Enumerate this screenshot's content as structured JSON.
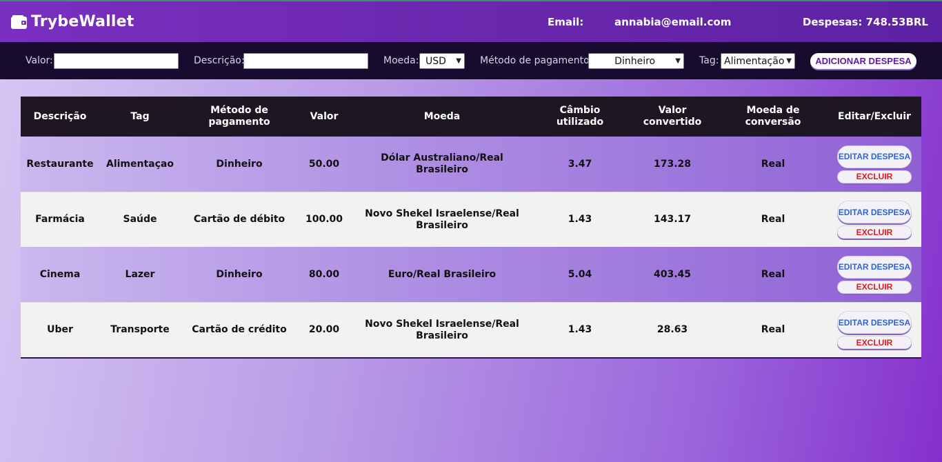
{
  "header": {
    "brand": "TrybeWallet",
    "email_label": "Email:",
    "email": "annabia@email.com",
    "expenses": "Despesas: 748.53BRL"
  },
  "form": {
    "value_label": "Valor:",
    "value": "",
    "description_label": "Descrição:",
    "description": "",
    "currency_label": "Moeda:",
    "currency": "USD",
    "method_label": "Método de pagamento:",
    "method": "Dinheiro",
    "tag_label": "Tag:",
    "tag": "Alimentação",
    "add_button": "ADICIONAR DESPESA"
  },
  "table": {
    "headers": [
      "Descrição",
      "Tag",
      "Método de pagamento",
      "Valor",
      "Moeda",
      "Câmbio utilizado",
      "Valor convertido",
      "Moeda de conversão",
      "Editar/Excluir"
    ],
    "edit_label": "EDITAR DESPESA",
    "delete_label": "EXCLUIR",
    "rows": [
      {
        "description": "Restaurante",
        "tag": "Alimentaçao",
        "method": "Dinheiro",
        "value": "50.00",
        "currency": "Dólar Australiano/Real Brasileiro",
        "rate": "3.47",
        "converted": "173.28",
        "conversion": "Real"
      },
      {
        "description": "Farmácia",
        "tag": "Saúde",
        "method": "Cartão de débito",
        "value": "100.00",
        "currency": "Novo Shekel Israelense/Real Brasileiro",
        "rate": "1.43",
        "converted": "143.17",
        "conversion": "Real"
      },
      {
        "description": "Cinema",
        "tag": "Lazer",
        "method": "Dinheiro",
        "value": "80.00",
        "currency": "Euro/Real Brasileiro",
        "rate": "5.04",
        "converted": "403.45",
        "conversion": "Real"
      },
      {
        "description": "Uber",
        "tag": "Transporte",
        "method": "Cartão de crédito",
        "value": "20.00",
        "currency": "Novo Shekel Israelense/Real Brasileiro",
        "rate": "1.43",
        "converted": "28.63",
        "conversion": "Real"
      }
    ]
  }
}
